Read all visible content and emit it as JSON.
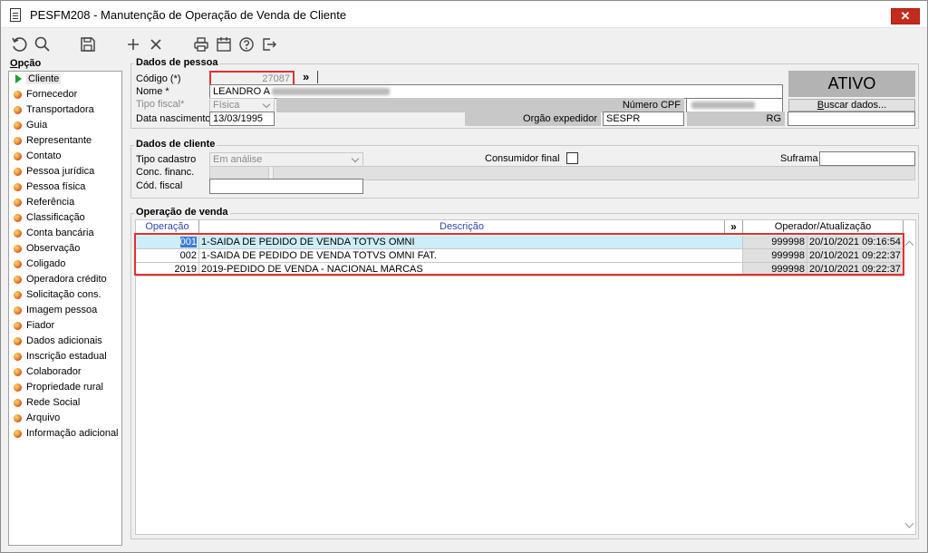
{
  "window": {
    "title": "PESFM208 - Manutenção de Operação de Venda de Cliente",
    "close": "✕"
  },
  "toolbar": [
    "refresh-icon",
    "search-icon",
    "save-icon",
    "add-icon",
    "delete-icon",
    "print-icon",
    "calendar-icon",
    "help-icon",
    "exit-icon"
  ],
  "sidebar": {
    "title_underlined": "O",
    "title_rest": "pção",
    "items": [
      "Cliente",
      "Fornecedor",
      "Transportadora",
      "Guia",
      "Representante",
      "Contato",
      "Pessoa jurídica",
      "Pessoa física",
      "Referência",
      "Classificação",
      "Conta bancária",
      "Observação",
      "Coligado",
      "Operadora crédito",
      "Solicitação cons.",
      "Imagem pessoa",
      "Fiador",
      "Dados adicionais",
      "Inscrição estadual",
      "Colaborador",
      "Propriedade rural",
      "Rede Social",
      "Arquivo",
      "Informação adicional"
    ]
  },
  "pessoa": {
    "group_title": "Dados de pessoa",
    "codigo_label": "Código (*)",
    "codigo_value": "27087",
    "expand": "»",
    "nome_label": "Nome *",
    "nome_value": "LEANDRO A",
    "tipo_fiscal_label": "Tipo fiscal*",
    "tipo_fiscal_value": "Física",
    "numero_cpf_label": "Número CPF",
    "data_nasc_label": "Data nascimento",
    "data_nasc_value": "13/03/1995",
    "orgao_label": "Orgão expedidor",
    "orgao_value": "SESPR",
    "rg_label": "RG",
    "status": "ATIVO",
    "buscar_u": "B",
    "buscar_rest": "uscar dados..."
  },
  "cliente": {
    "group_title": "Dados de cliente",
    "tipo_cadastro_label": "Tipo cadastro",
    "tipo_cadastro_value": "Em análise",
    "consumidor_label": "Consumidor final",
    "suframa_label": "Suframa",
    "conc_label": "Conc. financ.",
    "cod_fiscal_label": "Cód. fiscal"
  },
  "venda": {
    "group_title": "Operação de venda",
    "columns": {
      "operacao": "Operação",
      "descricao": "Descrição",
      "expand": "»",
      "operador": "Operador/Atualização"
    },
    "rows": [
      {
        "op": "001",
        "desc": "1-SAIDA DE PEDIDO DE VENDA TOTVS OMNI",
        "operador": "999998",
        "data": "20/10/2021 09:16:54"
      },
      {
        "op": "002",
        "desc": "1-SAIDA DE PEDIDO DE VENDA TOTVS OMNI FAT.",
        "operador": "999998",
        "data": "20/10/2021 09:22:37"
      },
      {
        "op": "2019",
        "desc": "2019-PEDIDO DE VENDA - NACIONAL MARCAS",
        "operador": "999998",
        "data": "20/10/2021 09:22:37"
      }
    ]
  }
}
